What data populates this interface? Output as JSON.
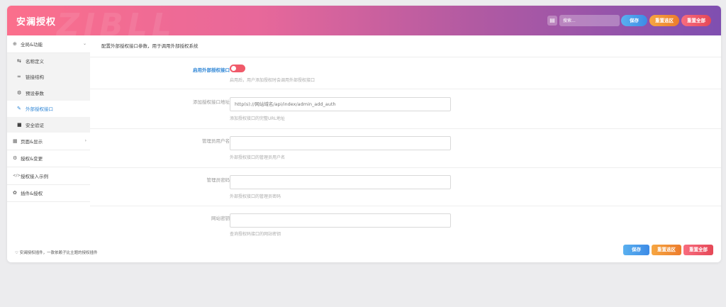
{
  "header": {
    "title": "安澜授权",
    "watermark": "ZIBLL",
    "menu_icon": "▤",
    "search_placeholder": "搜索...",
    "save_label": "保存",
    "reset_section_label": "重置选区",
    "reset_all_label": "重置全部"
  },
  "sidebar": {
    "items": [
      {
        "icon": "globe-icon",
        "glyph": "⊕",
        "label": "全局&功能",
        "expanded": true
      },
      {
        "icon": "calendar-icon",
        "glyph": "▦",
        "label": "页面&显示"
      },
      {
        "icon": "gear-icon",
        "glyph": "⚙",
        "label": "授权&变更"
      },
      {
        "icon": "code-icon",
        "glyph": "</>",
        "label": "授权接入示例"
      },
      {
        "icon": "plugin-icon",
        "glyph": "✿",
        "label": "插件&授权"
      }
    ],
    "sub_items": [
      {
        "icon": "retweet-icon",
        "glyph": "⇆",
        "label": "名称定义"
      },
      {
        "icon": "link-icon",
        "glyph": "🔗",
        "label": "链接结构"
      },
      {
        "icon": "cogs-icon",
        "glyph": "⚙",
        "label": "预设参数"
      },
      {
        "icon": "plug-icon",
        "glyph": "✎",
        "label": "外部授权接口",
        "active": true
      },
      {
        "icon": "lock-icon",
        "glyph": "🔒",
        "label": "安全验证"
      }
    ]
  },
  "content": {
    "description": "配置外部授权接口参数，用于调用外部授权系统",
    "fields": [
      {
        "label": "启用外部授权接口",
        "type": "toggle",
        "enabled": true,
        "hint": "启用后，用户添加授权时会调用外部授权接口"
      },
      {
        "label": "添加授权接口地址",
        "type": "text",
        "value": "http(s)://网站域名/api/index/admin_add_auth",
        "hint": "添加授权接口的完整URL地址"
      },
      {
        "label": "管理员用户名",
        "type": "text",
        "value": "",
        "hint": "外部授权接口的管理员用户名"
      },
      {
        "label": "管理员密码",
        "type": "text",
        "value": "",
        "hint": "外部授权接口的管理员密码"
      },
      {
        "label": "网站密钥",
        "type": "text",
        "value": "",
        "hint": "查询授权码接口的网站密钥"
      }
    ]
  },
  "footer": {
    "text": "♡ 安澜授权插件，一款依赖子比主题的授权插件",
    "save_label": "保存",
    "reset_section_label": "重置选区",
    "reset_all_label": "重置全部"
  },
  "colors": {
    "header_gradient": [
      "#fb6f8c",
      "#7f4fb0"
    ],
    "accent_blue": "#2f86d6",
    "save": "#3d8be6",
    "reset_section": "#ec7c2c",
    "reset_all": "#e54857",
    "toggle_on": "#f05a6a"
  }
}
